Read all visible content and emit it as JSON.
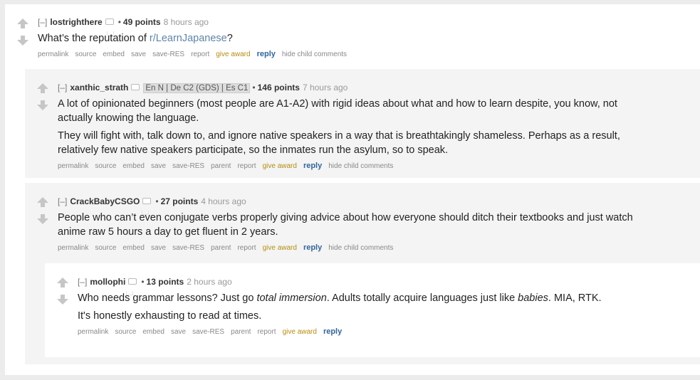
{
  "comments": [
    {
      "toggle": "[–]",
      "author": "lostrighthere",
      "score": "49 points",
      "time": "8 hours ago",
      "body_prefix": "What’s the reputation of ",
      "body_link": "r/LearnJapanese",
      "body_suffix": "?",
      "buttons": [
        "permalink",
        "source",
        "embed",
        "save",
        "save-RES",
        "report",
        "give award",
        "reply",
        "hide child comments"
      ]
    },
    {
      "toggle": "[–]",
      "author": "xanthic_strath",
      "flair": "En N | De C2 (GDS) | Es C1",
      "score": "146 points",
      "time": "7 hours ago",
      "paragraphs": [
        "A lot of opinionated beginners (most people are A1-A2) with rigid ideas about what and how to learn despite, you know, not actually knowing the language.",
        "They will fight with, talk down to, and ignore native speakers in a way that is breathtakingly shameless. Perhaps as a result, relatively few native speakers participate, so the inmates run the asylum, so to speak."
      ],
      "buttons": [
        "permalink",
        "source",
        "embed",
        "save",
        "save-RES",
        "parent",
        "report",
        "give award",
        "reply",
        "hide child comments"
      ]
    },
    {
      "toggle": "[–]",
      "author": "CrackBabyCSGO",
      "score": "27 points",
      "time": "4 hours ago",
      "paragraphs": [
        "People who can’t even conjugate verbs properly giving advice about how everyone should ditch their textbooks and just watch anime raw 5 hours a day to get fluent in 2 years."
      ],
      "buttons": [
        "permalink",
        "source",
        "embed",
        "save",
        "save-RES",
        "parent",
        "report",
        "give award",
        "reply",
        "hide child comments"
      ]
    },
    {
      "toggle": "[–]",
      "author": "mollophi",
      "score": "13 points",
      "time": "2 hours ago",
      "line1_a": "Who needs grammar lessons? Just go ",
      "line1_em1": "total immersion",
      "line1_b": ". Adults totally acquire languages just like ",
      "line1_em2": "babies",
      "line1_c": ". MIA, RTK.",
      "line2": "It's honestly exhausting to read at times.",
      "buttons": [
        "permalink",
        "source",
        "embed",
        "save",
        "save-RES",
        "parent",
        "report",
        "give award",
        "reply"
      ]
    }
  ],
  "colors": {
    "page_bg": "#ececec",
    "nested_bg": "#f4f4f4",
    "award": "#b48d0f",
    "reply": "#336699",
    "link": "#5f84a8",
    "arrow": "#c6c6c6"
  }
}
